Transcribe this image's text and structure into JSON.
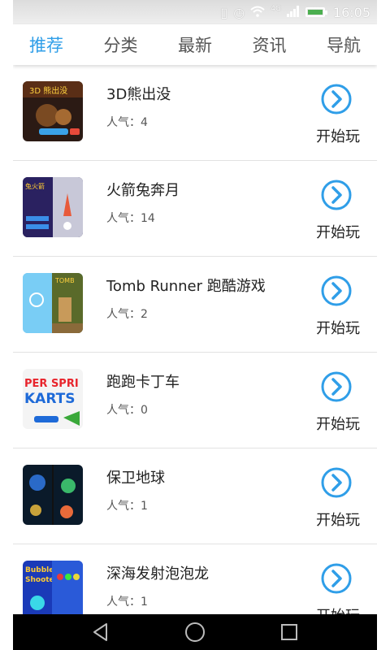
{
  "status_bar": {
    "time": "16:05",
    "network": "4G"
  },
  "tabs": [
    {
      "label": "推荐",
      "active": true
    },
    {
      "label": "分类",
      "active": false
    },
    {
      "label": "最新",
      "active": false
    },
    {
      "label": "资讯",
      "active": false
    },
    {
      "label": "导航",
      "active": false
    }
  ],
  "games": [
    {
      "name": "3D熊出没",
      "popularity": "人气：4",
      "play_label": "开始玩"
    },
    {
      "name": "火箭兔奔月",
      "popularity": "人气：14",
      "play_label": "开始玩"
    },
    {
      "name": "Tomb Runner 跑酷游戏",
      "popularity": "人气：2",
      "play_label": "开始玩"
    },
    {
      "name": "跑跑卡丁车",
      "popularity": "人气：0",
      "play_label": "开始玩"
    },
    {
      "name": "保卫地球",
      "popularity": "人气：1",
      "play_label": "开始玩"
    },
    {
      "name": "深海发射泡泡龙",
      "popularity": "人气：1",
      "play_label": "开始玩"
    }
  ],
  "colors": {
    "accent": "#2f9ee8",
    "divider": "#e2e2e2"
  }
}
